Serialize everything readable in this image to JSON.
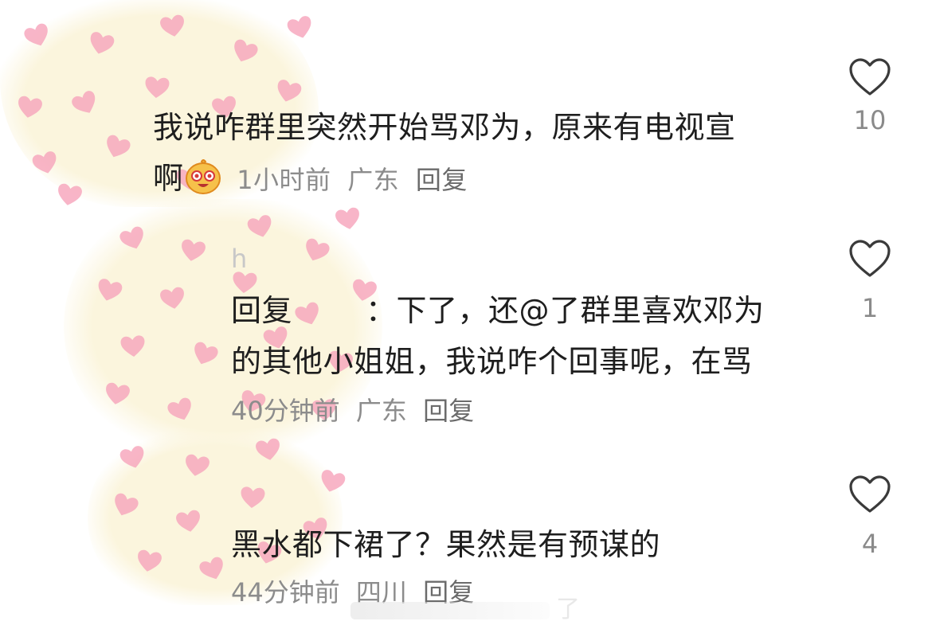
{
  "comments": [
    {
      "text_line1": "我说咋群里突然开始骂邓为，原来有电视宣",
      "text_line2": "啊",
      "emoji": "grinning-face-icon",
      "time": "1小时前",
      "location": "广东",
      "reply_label": "回复",
      "likes": "10"
    },
    {
      "avatar_initial": "h",
      "reply_prefix": "回复",
      "text_line1_rest": "：下了，还@了群里喜欢邓为",
      "text_line2": "的其他小姐姐，我说咋个回事呢，在骂",
      "time": "40分钟前",
      "location": "广东",
      "reply_label": "回复",
      "likes": "1"
    },
    {
      "text_line1": "黑水都下裙了？果然是有预谋的",
      "time": "44分钟前",
      "location": "四川",
      "reply_label": "回复",
      "likes": "4"
    }
  ],
  "watermark": "了",
  "colors": {
    "heart": "#f7a6bd",
    "sticker_bg": "#fbf5dd",
    "text": "#1e1e1e",
    "meta": "#8c8c8c"
  }
}
